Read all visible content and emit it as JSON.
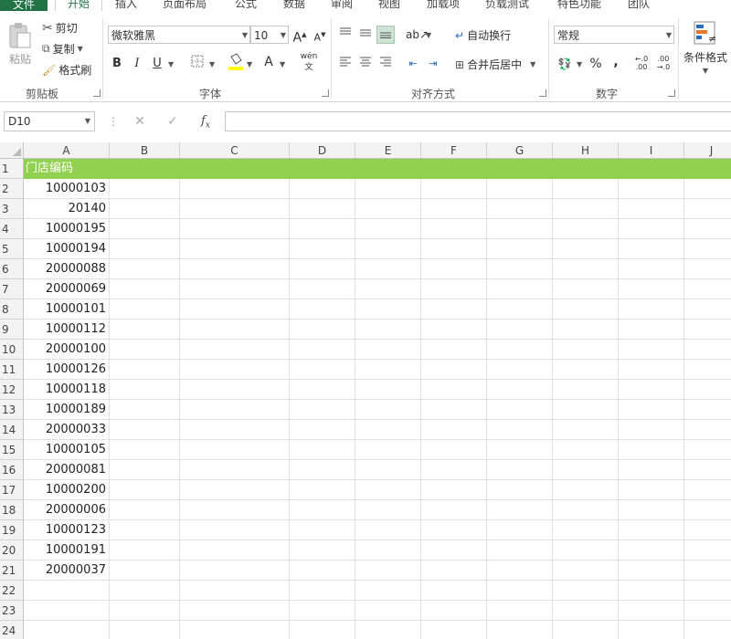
{
  "tabs": [
    "文件",
    "开始",
    "插入",
    "页面布局",
    "公式",
    "数据",
    "审阅",
    "视图",
    "加载项",
    "负载测试",
    "特色功能",
    "团队"
  ],
  "clipboard": {
    "paste": "粘贴",
    "cut": "剪切",
    "copy": "复制",
    "format_painter": "格式刷",
    "group": "剪贴板"
  },
  "font": {
    "name": "微软雅黑",
    "size": "10",
    "group": "字体",
    "bold": "B",
    "italic": "I",
    "underline": "U",
    "grow": "A",
    "shrink": "A",
    "font_color": "A",
    "phonetic": "wén"
  },
  "alignment": {
    "wrap": "自动换行",
    "merge": "合并后居中",
    "group": "对齐方式"
  },
  "number": {
    "format": "常规",
    "percent": "%",
    "comma": ",",
    "group": "数字",
    "inc_decimal": ".00",
    "dec_decimal": ".00"
  },
  "styles": {
    "conditional": "条件格式"
  },
  "formula_bar": {
    "name_box": "D10",
    "fx": "fx",
    "cancel": "✕",
    "enter": "✓",
    "formula": ""
  },
  "columns": [
    "A",
    "B",
    "C",
    "D",
    "E",
    "F",
    "G",
    "H",
    "I",
    "J"
  ],
  "rows": [
    "1",
    "2",
    "3",
    "4",
    "5",
    "6",
    "7",
    "8",
    "9",
    "10",
    "11",
    "12",
    "13",
    "14",
    "15",
    "16",
    "17",
    "18",
    "19",
    "20",
    "21",
    "22",
    "23",
    "24"
  ],
  "header_cell": "门店编码",
  "values": [
    "10000103",
    "20140",
    "10000195",
    "10000194",
    "20000088",
    "20000069",
    "10000101",
    "10000112",
    "20000100",
    "10000126",
    "10000118",
    "10000189",
    "20000033",
    "10000105",
    "20000081",
    "10000200",
    "20000006",
    "10000123",
    "10000191",
    "20000037"
  ],
  "colors": {
    "header_fill": "#92d050",
    "accent": "#217346"
  }
}
